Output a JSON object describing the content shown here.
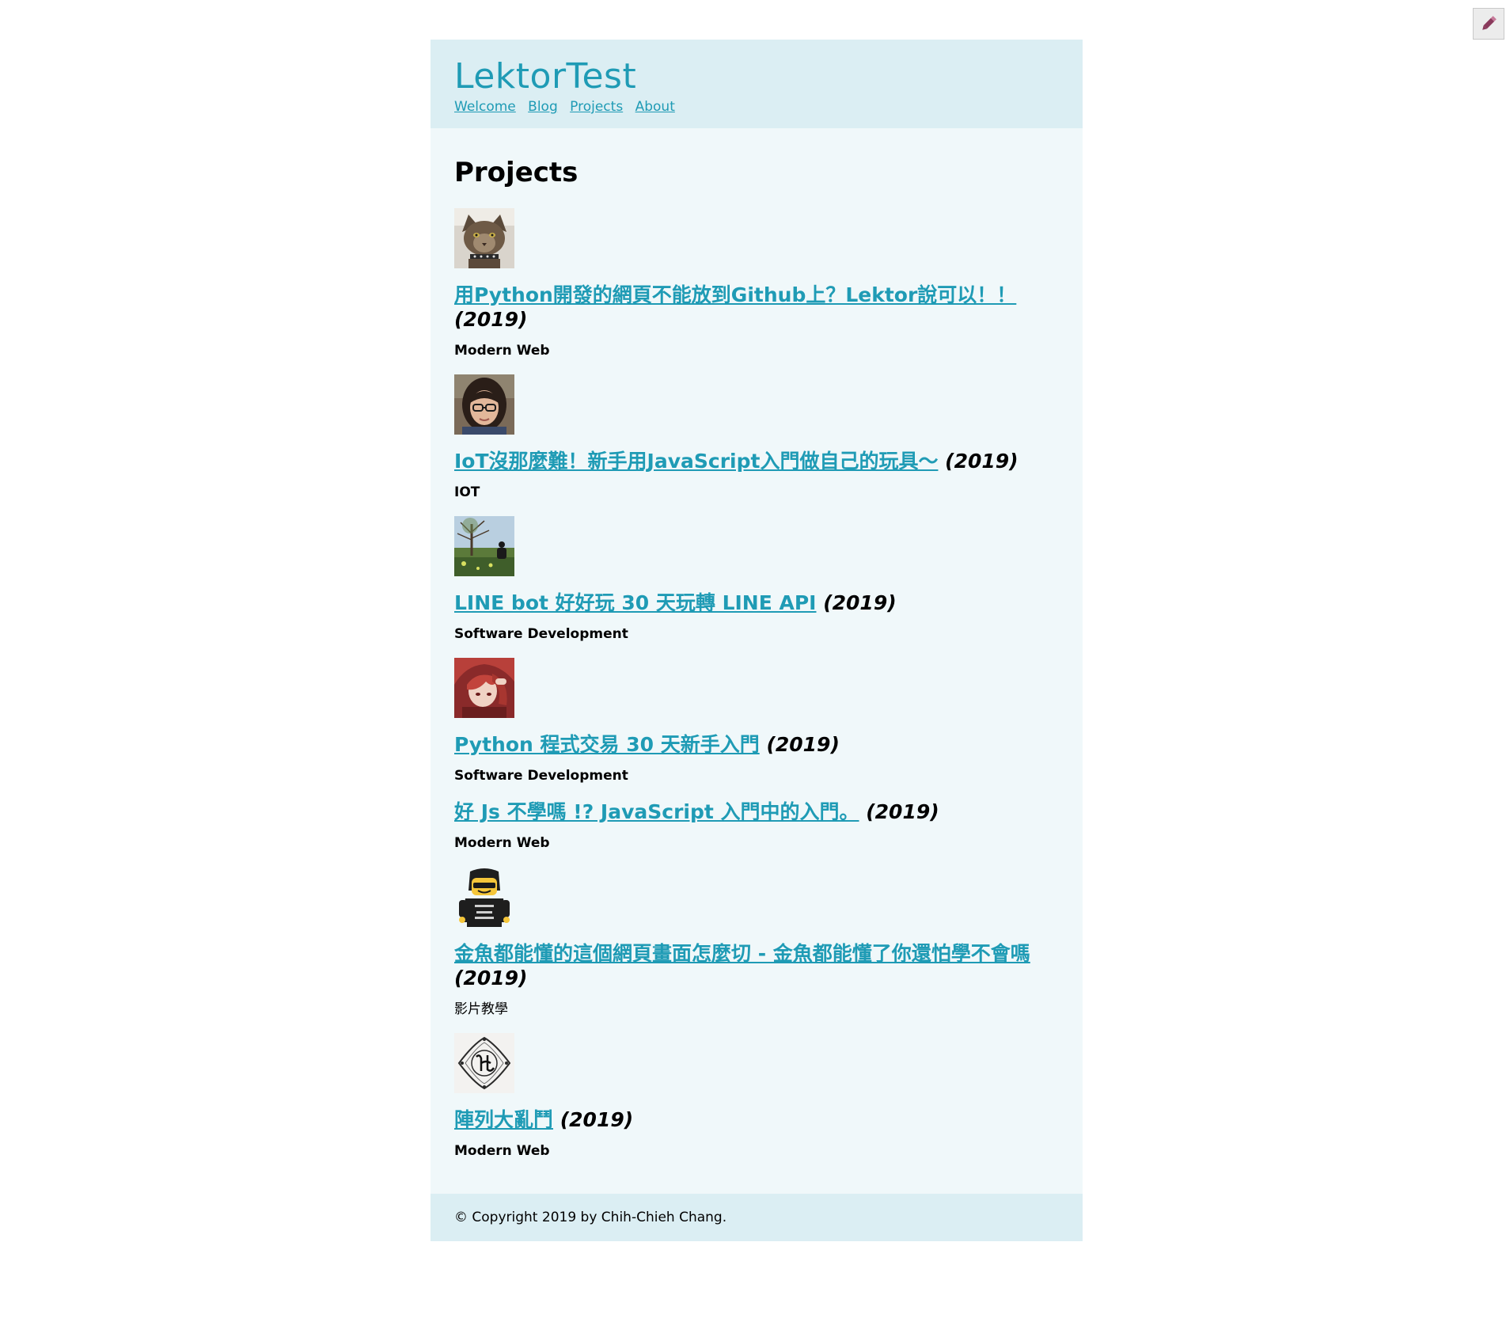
{
  "site": {
    "title": "LektorTest",
    "nav": [
      "Welcome",
      "Blog",
      "Projects",
      "About"
    ]
  },
  "page": {
    "heading": "Projects"
  },
  "projects": [
    {
      "title": "用Python開發的網頁不能放到Github上？Lektor說可以！！",
      "year": "(2019)",
      "category": "Modern Web",
      "thumb_icon": "cat-photo"
    },
    {
      "title": "IoT沒那麼難！新手用JavaScript入門做自己的玩具～",
      "year": "(2019)",
      "category": "IOT",
      "thumb_icon": "woman-portrait-photo"
    },
    {
      "title": "LINE bot 好好玩 30 天玩轉 LINE API",
      "year": "(2019)",
      "category": "Software Development",
      "thumb_icon": "person-under-tree-photo"
    },
    {
      "title": "Python 程式交易 30 天新手入門",
      "year": "(2019)",
      "category": "Software Development",
      "thumb_icon": "anime-red-hair-avatar"
    },
    {
      "title": "好 Js 不學嗎 !? JavaScript 入門中的入門。",
      "year": "(2019)",
      "category": "Modern Web"
    },
    {
      "title": "金魚都能懂的這個網頁畫面怎麼切 - 金魚都能懂了你還怕學不會嗎",
      "year": "(2019)",
      "category": "影片教學",
      "thumb_icon": "lego-minifigure-avatar"
    },
    {
      "title": "陣列大亂鬥",
      "year": "(2019)",
      "category": "Modern Web",
      "thumb_icon": "ornamental-monogram-logo"
    }
  ],
  "footer": {
    "text": "© Copyright 2019 by Chih-Chieh Chang."
  },
  "edit_button": {
    "icon": "pencil-icon"
  },
  "colors": {
    "link": "#1f9bb5",
    "header_bg": "#dbeef3",
    "content_bg": "#f0f8fa"
  }
}
